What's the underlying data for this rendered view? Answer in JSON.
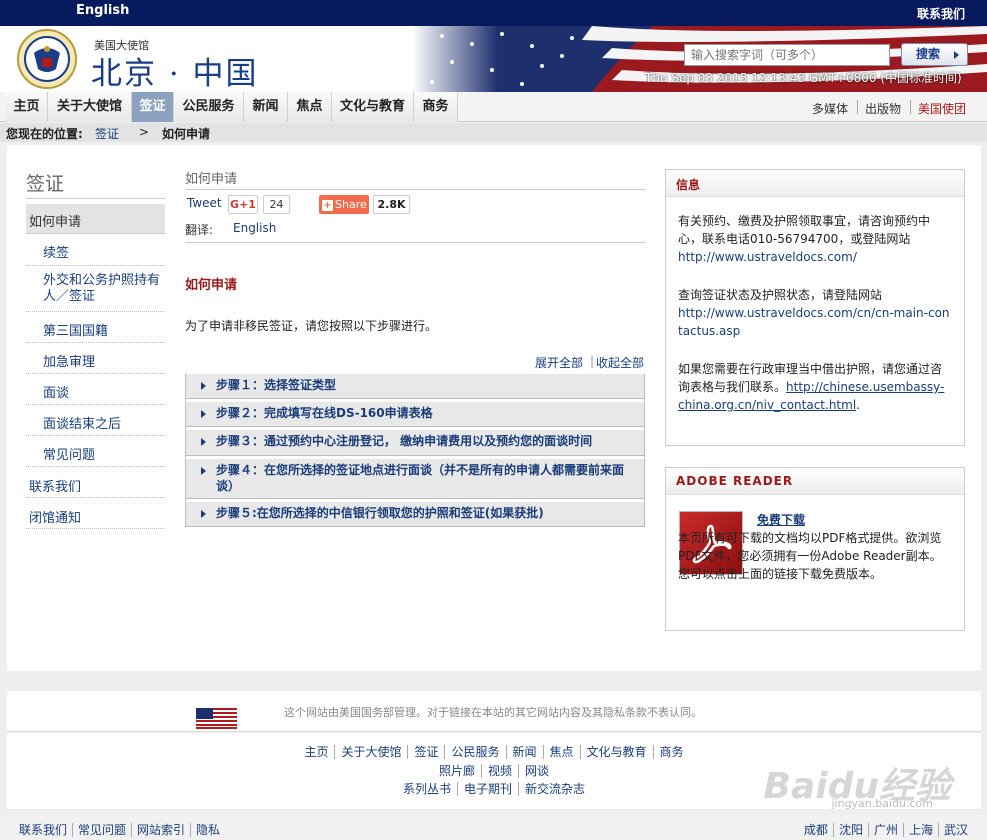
{
  "topbar": {
    "language": "English",
    "contact": "联系我们"
  },
  "banner": {
    "embassy_small": "美国大使馆",
    "embassy_big": "北京 · 中国",
    "search_placeholder": "输入搜索字词（可多个）",
    "search_button": "搜索",
    "datetime": "Thu Sep 03 2015 12:13:43 GMT+0800 (中国标准时间)"
  },
  "nav": {
    "items": [
      {
        "label": "主页"
      },
      {
        "label": "关于大使馆"
      },
      {
        "label": "签证",
        "active": true
      },
      {
        "label": "公民服务"
      },
      {
        "label": "新闻"
      },
      {
        "label": "焦点"
      },
      {
        "label": "文化与教育"
      },
      {
        "label": "商务"
      }
    ],
    "right": [
      "多媒体",
      "出版物",
      "美国使团"
    ]
  },
  "breadcrumb": {
    "prefix": "您现在的位置:",
    "parent": "签证",
    "separator": ">",
    "current": "如何申请"
  },
  "left_nav": {
    "title": "签证",
    "items": [
      {
        "label": "如何申请",
        "level": "top",
        "active": true
      },
      {
        "label": "续签",
        "level": "sub"
      },
      {
        "label": "外交和公务护照持有人／签证",
        "level": "sub"
      },
      {
        "label": "第三国国籍",
        "level": "sub"
      },
      {
        "label": "加急审理",
        "level": "sub"
      },
      {
        "label": "面谈",
        "level": "sub"
      },
      {
        "label": "面谈结束之后",
        "level": "sub"
      },
      {
        "label": "常见问题",
        "level": "sub"
      },
      {
        "label": "联系我们",
        "level": "top"
      },
      {
        "label": "闭馆通知",
        "level": "top"
      }
    ]
  },
  "content": {
    "title": "如何申请",
    "tweet": "Tweet",
    "gplus": "G+1",
    "gplus_count": "24",
    "share": "Share",
    "share_count": "2.8K",
    "translate_label": "翻译:",
    "translate_link": "English",
    "section_heading": "如何申请",
    "intro": "为了申请非移民签证，请您按照以下步骤进行。",
    "expand_all": "展开全部",
    "collapse_all": "收起全部",
    "steps": [
      "步骤１：选择签证类型",
      "步骤２：完成填写在线DS-160申请表格",
      "步骤３：通过预约中心注册登记， 缴纳申请费用以及预约您的面谈时间",
      "步骤４：在您所选择的签证地点进行面谈（并不是所有的申请人都需要前来面谈）",
      "步骤５:在您所选择的中信银行领取您的护照和签证(如果获批)"
    ]
  },
  "info_box": {
    "heading": "信息",
    "p1_text": "有关预约、缴费及护照领取事宜，请咨询预约中心，联系电话010-56794700，或登陆网站",
    "p1_link": "http://www.ustraveldocs.com/",
    "p2_text": "查询签证状态及护照状态，请登陆网站",
    "p2_link": "http://www.ustraveldocs.com/cn/cn-main-contactus.asp",
    "p3_text": "如果您需要在行政审理当中借出护照，请您通过咨询表格与我们联系。",
    "p3_link": "http://chinese.usembassy-china.org.cn/niv_contact.html",
    "p3_end": "."
  },
  "adobe_box": {
    "heading": "ADOBE READER",
    "link": "免费下载",
    "text": "本页所有可下载的文档均以PDF格式提供。欲浏览PDF文件，您必须拥有一份Adobe Reader副本。您可以点击上面的链接下载免费版本。"
  },
  "footer": {
    "note": "这个网站由美国国务部管理。对于链接在本站的其它网站内容及其隐私条款不表认同。",
    "row1": [
      "主页",
      "关于大使馆",
      "签证",
      "公民服务",
      "新闻",
      "焦点",
      "文化与教育",
      "商务"
    ],
    "row2": [
      "照片廊",
      "视频",
      "网谈"
    ],
    "row3": [
      "系列丛书",
      "电子期刊",
      "新交流杂志"
    ],
    "bottom_left": [
      "联系我们",
      "常见问题",
      "网站索引",
      "隐私"
    ],
    "bottom_right": [
      "成都",
      "沈阳",
      "广州",
      "上海",
      "武汉"
    ],
    "watermark": "Baidu经验",
    "watermark_sub": "jingyan.baidu.com"
  },
  "colors": {
    "navy": "#081a5e",
    "accent_red": "#9a1a1a",
    "link": "#1a3d7a",
    "active_tab": "#8ba2c0"
  },
  "icons": [
    "embassy-seal-icon",
    "american-flag-banner",
    "search-arrow-icon",
    "step-arrow-icon",
    "adobe-pdf-icon",
    "us-flag-icon"
  ]
}
